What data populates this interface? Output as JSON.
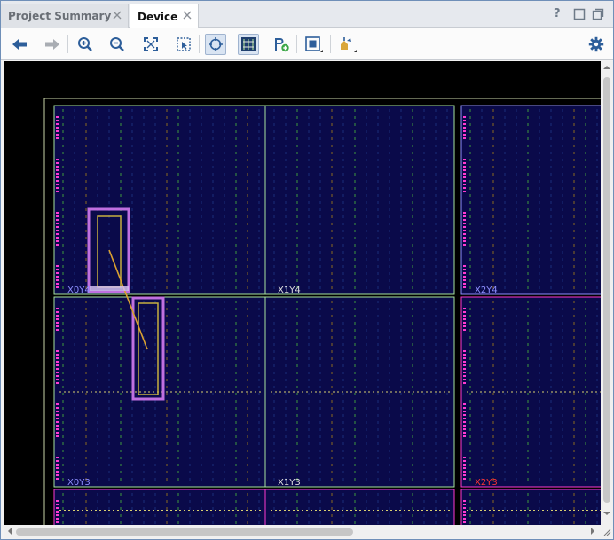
{
  "tabs": [
    {
      "label": "Project Summary",
      "active": false
    },
    {
      "label": "Device",
      "active": true
    }
  ],
  "window_controls": {
    "help": "?",
    "restore": "restore-icon",
    "maximize": "maximize-icon"
  },
  "toolbar": {
    "buttons": [
      "back-arrow-icon",
      "forward-arrow-icon",
      "zoom-in-icon",
      "zoom-out-icon",
      "zoom-fit-icon",
      "zoom-selection-icon",
      "auto-fit-selection-icon",
      "routing-resources-icon",
      "place-io-icon",
      "pblock-icon",
      "highlight-icon",
      "settings-gear-icon"
    ],
    "active_buttons": [
      "auto-fit-selection-icon",
      "routing-resources-icon"
    ]
  },
  "device": {
    "clock_regions": [
      {
        "name": "X0Y4",
        "color": "#8f8fff"
      },
      {
        "name": "X1Y4",
        "color": "#e0e0e0"
      },
      {
        "name": "X2Y4",
        "color": "#8f8fff"
      },
      {
        "name": "X0Y3",
        "color": "#8f8fff"
      },
      {
        "name": "X1Y3",
        "color": "#e0e0e0"
      },
      {
        "name": "X2Y3",
        "color": "#ff3333"
      }
    ],
    "colors": {
      "background": "#000000",
      "fabric": "#0a0a4a",
      "region_border_green": "#a8e4a0",
      "pblock": "#c070e0",
      "placed_cells": "#c8b040",
      "io_pins": "#ff3ad0"
    }
  }
}
